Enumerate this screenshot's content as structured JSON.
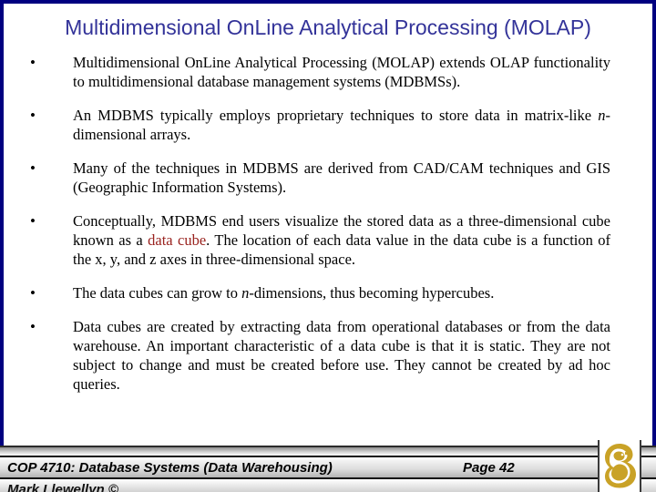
{
  "slide": {
    "title": "Multidimensional OnLine Analytical Processing (MOLAP)",
    "title_color": "#333399",
    "border_color": "#000080",
    "background": "#ffffff",
    "bullet_marker": "•",
    "bullets": [
      {
        "id": "bullet-molap-extends",
        "parts": [
          {
            "text": "Multidimensional OnLine Analytical Processing (MOLAP) extends OLAP functionality to multidimensional database management systems (MDBMSs).",
            "style": "normal"
          }
        ]
      },
      {
        "id": "bullet-proprietary-techniques",
        "parts": [
          {
            "text": "An MDBMS typically employs proprietary techniques to store data in matrix-like ",
            "style": "normal"
          },
          {
            "text": "n",
            "style": "italic"
          },
          {
            "text": "-dimensional arrays.",
            "style": "normal"
          }
        ]
      },
      {
        "id": "bullet-cadcam-gis",
        "parts": [
          {
            "text": "Many of the techniques in MDBMS are derived from CAD/CAM techniques and GIS (Geographic Information Systems).",
            "style": "normal"
          }
        ]
      },
      {
        "id": "bullet-data-cube",
        "parts": [
          {
            "text": "Conceptually, MDBMS end users visualize the stored data as a three-dimensional cube known as a ",
            "style": "normal"
          },
          {
            "text": "data cube",
            "style": "red"
          },
          {
            "text": ".  The location of each data value in the data cube is a function of the x, y, and z axes in three-dimensional space.",
            "style": "normal"
          }
        ]
      },
      {
        "id": "bullet-hypercubes",
        "parts": [
          {
            "text": "The data cubes can grow to ",
            "style": "normal"
          },
          {
            "text": "n",
            "style": "italic"
          },
          {
            "text": "-dimensions, thus becoming hypercubes.",
            "style": "normal"
          }
        ]
      },
      {
        "id": "bullet-static-cubes",
        "parts": [
          {
            "text": "Data cubes are created by extracting data from operational databases or from the data warehouse.  An important characteristic of a data cube is that it is static.  They are not subject to change and must be created before use.  They cannot be created by ad hoc queries.",
            "style": "normal"
          }
        ]
      }
    ],
    "highlight_color": "#99221e"
  },
  "footer": {
    "course": "COP 4710: Database Systems  (Data Warehousing)",
    "page": "Page 42",
    "author": "Mark Llewellyn ©",
    "logo_name": "ucf-pegasus-logo",
    "logo_color": "#c9a227"
  }
}
